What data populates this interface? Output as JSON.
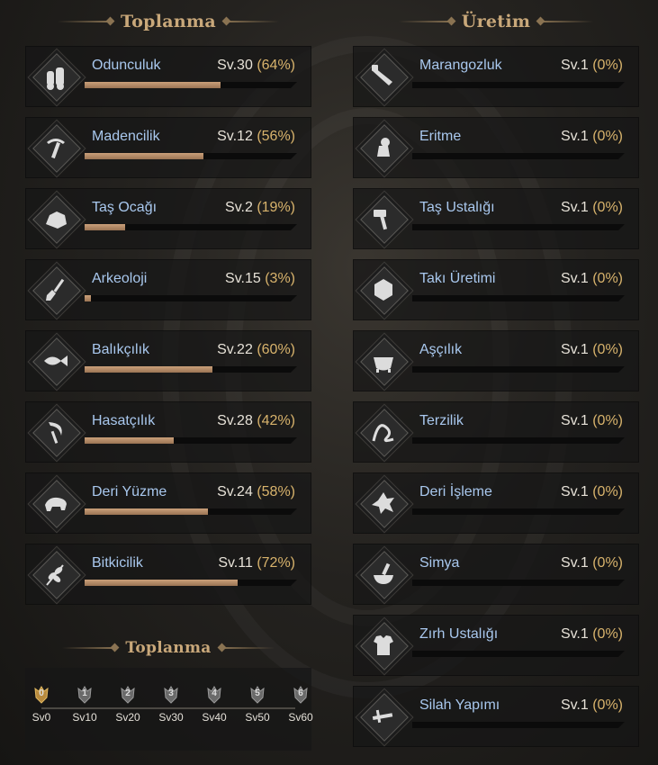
{
  "colors": {
    "header": "#c9a87a",
    "skill_name": "#a9c8ee",
    "percent": "#d8b36c",
    "bar_fill": "#b48a66"
  },
  "gathering": {
    "title": "Toplanma",
    "skills": [
      {
        "name": "Odunculuk",
        "level": "Sv.30",
        "percent": "(64%)",
        "progress": 0.64,
        "icon": "logs-icon"
      },
      {
        "name": "Madencilik",
        "level": "Sv.12",
        "percent": "(56%)",
        "progress": 0.56,
        "icon": "pickaxe-icon"
      },
      {
        "name": "Taş Ocağı",
        "level": "Sv.2",
        "percent": "(19%)",
        "progress": 0.19,
        "icon": "stone-icon"
      },
      {
        "name": "Arkeoloji",
        "level": "Sv.15",
        "percent": "(3%)",
        "progress": 0.03,
        "icon": "shovel-icon"
      },
      {
        "name": "Balıkçılık",
        "level": "Sv.22",
        "percent": "(60%)",
        "progress": 0.6,
        "icon": "fish-icon"
      },
      {
        "name": "Hasatçılık",
        "level": "Sv.28",
        "percent": "(42%)",
        "progress": 0.42,
        "icon": "sickle-icon"
      },
      {
        "name": "Deri Yüzme",
        "level": "Sv.24",
        "percent": "(58%)",
        "progress": 0.58,
        "icon": "boar-icon"
      },
      {
        "name": "Bitkicilik",
        "level": "Sv.11",
        "percent": "(72%)",
        "progress": 0.72,
        "icon": "herb-icon"
      }
    ]
  },
  "production": {
    "title": "Üretim",
    "skills": [
      {
        "name": "Marangozluk",
        "level": "Sv.1",
        "percent": "(0%)",
        "progress": 0,
        "icon": "saw-icon"
      },
      {
        "name": "Eritme",
        "level": "Sv.1",
        "percent": "(0%)",
        "progress": 0,
        "icon": "furnace-icon"
      },
      {
        "name": "Taş Ustalığı",
        "level": "Sv.1",
        "percent": "(0%)",
        "progress": 0,
        "icon": "hammer-icon"
      },
      {
        "name": "Takı Üretimi",
        "level": "Sv.1",
        "percent": "(0%)",
        "progress": 0,
        "icon": "gem-icon"
      },
      {
        "name": "Aşçılık",
        "level": "Sv.1",
        "percent": "(0%)",
        "progress": 0,
        "icon": "cauldron-icon"
      },
      {
        "name": "Terzilik",
        "level": "Sv.1",
        "percent": "(0%)",
        "progress": 0,
        "icon": "thread-icon"
      },
      {
        "name": "Deri İşleme",
        "level": "Sv.1",
        "percent": "(0%)",
        "progress": 0,
        "icon": "hide-icon"
      },
      {
        "name": "Simya",
        "level": "Sv.1",
        "percent": "(0%)",
        "progress": 0,
        "icon": "mortar-icon"
      },
      {
        "name": "Zırh Ustalığı",
        "level": "Sv.1",
        "percent": "(0%)",
        "progress": 0,
        "icon": "armor-icon"
      },
      {
        "name": "Silah Yapımı",
        "level": "Sv.1",
        "percent": "(0%)",
        "progress": 0,
        "icon": "sword-icon"
      }
    ]
  },
  "tiers": {
    "title": "Toplanma",
    "items": [
      {
        "badge": "0",
        "label": "Sv0",
        "active": true
      },
      {
        "badge": "1",
        "label": "Sv10",
        "active": false
      },
      {
        "badge": "2",
        "label": "Sv20",
        "active": false
      },
      {
        "badge": "3",
        "label": "Sv30",
        "active": false
      },
      {
        "badge": "4",
        "label": "Sv40",
        "active": false
      },
      {
        "badge": "5",
        "label": "Sv50",
        "active": false
      },
      {
        "badge": "6",
        "label": "Sv60",
        "active": false
      }
    ]
  }
}
